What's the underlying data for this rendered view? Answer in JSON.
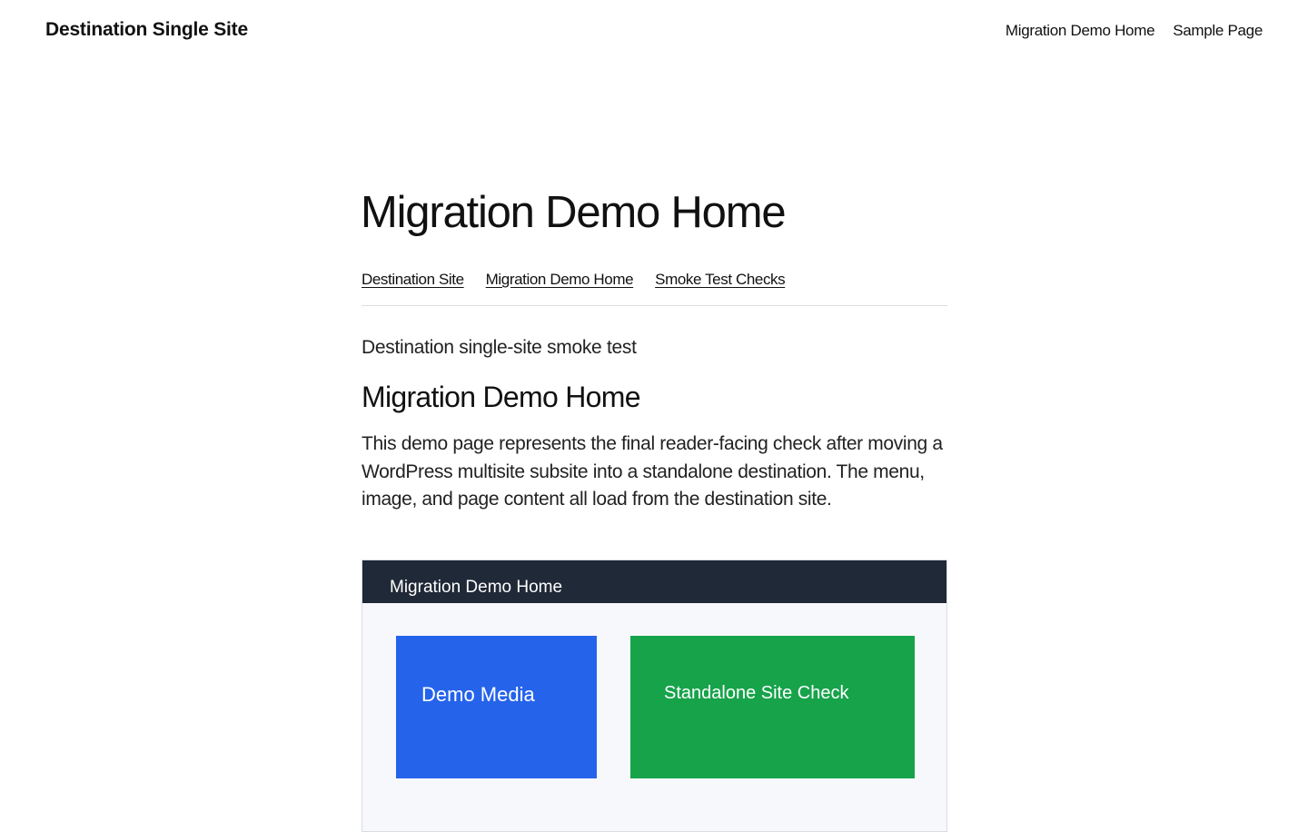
{
  "site": {
    "title": "Destination Single Site",
    "nav": [
      "Migration Demo Home",
      "Sample Page"
    ]
  },
  "page": {
    "title": "Migration Demo Home",
    "subnav": [
      "Destination Site",
      "Migration Demo Home",
      "Smoke Test Checks"
    ],
    "tagline": "Destination single-site smoke test",
    "section_heading": "Migration Demo Home",
    "body": "This demo page represents the final reader-facing check after moving a WordPress multisite subsite into a standalone destination. The menu, image, and page content all load from the destination site."
  },
  "figure": {
    "title": "Migration Demo Home",
    "tiles": [
      {
        "label": "Demo Media",
        "color": "#2563eb"
      },
      {
        "label": "Standalone Site Check",
        "color": "#16a34a"
      }
    ],
    "bar_color": "#1f2937"
  }
}
